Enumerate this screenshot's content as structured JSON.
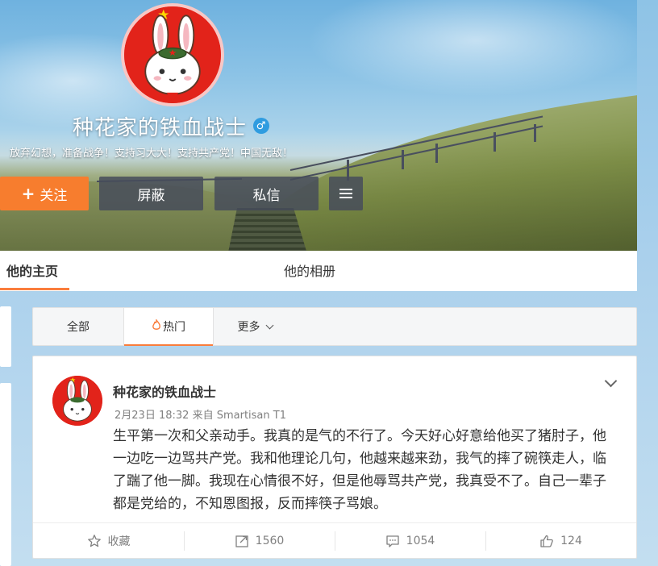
{
  "profile": {
    "name": "种花家的铁血战士",
    "gender_symbol": "♂",
    "bio": "放弃幻想，准备战争！支持习大大！支持共产党！中国无敌！",
    "buttons": {
      "follow": "关注",
      "follow_plus": "+",
      "block": "屏蔽",
      "message": "私信"
    }
  },
  "nav": {
    "home": "他的主页",
    "album": "他的相册"
  },
  "filter_tabs": {
    "all": "全部",
    "hot": "热门",
    "more": "更多"
  },
  "post": {
    "author": "种花家的铁血战士",
    "time": "2月23日 18:32",
    "source_prefix": "来自",
    "source": "Smartisan T1",
    "text": "生平第一次和父亲动手。我真的是气的不行了。今天好心好意给他买了猪肘子，他一边吃一边骂共产党。我和他理论几句，他越来越来劲，我气的摔了碗筷走人，临了踹了他一脚。我现在心情很不好，但是他辱骂共产党，我真受不了。自己一辈子都是党给的，不知恩图报，反而摔筷子骂娘。",
    "actions": {
      "favorite": "收藏",
      "forward": "1560",
      "comment": "1054",
      "like": "124"
    }
  },
  "colors": {
    "accent_orange": "#f77d2e",
    "dark_button": "#464c5a",
    "avatar_red": "#e2231a",
    "gender_blue": "#2f9ce0"
  },
  "icons": [
    "male-icon",
    "hamburger-icon",
    "flame-icon",
    "chevron-down-icon",
    "star-icon",
    "forward-icon",
    "comment-icon",
    "thumbs-up-icon"
  ]
}
